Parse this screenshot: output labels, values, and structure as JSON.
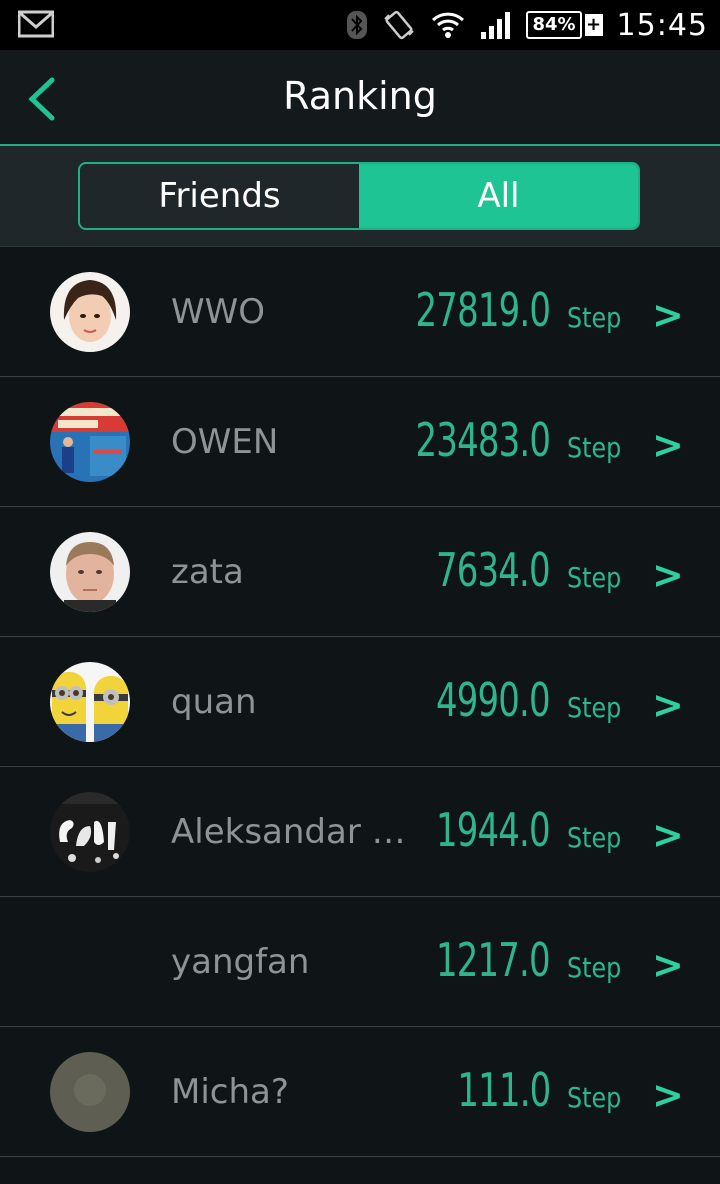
{
  "status_bar": {
    "time": "15:45",
    "battery": "84%",
    "battery_plus": "+",
    "icons": [
      "gmail-icon",
      "bluetooth-icon",
      "vibrate-icon",
      "wifi-icon",
      "signal-icon",
      "battery-icon"
    ]
  },
  "header": {
    "title": "Ranking",
    "back_icon": "chevron-left-icon"
  },
  "tabs": [
    {
      "label": "Friends",
      "active": false
    },
    {
      "label": "All",
      "active": true
    }
  ],
  "ranking": [
    {
      "name": "WWO",
      "steps": "27819.0",
      "unit": "Step",
      "arrow": ">",
      "avatar": "woman-photo"
    },
    {
      "name": "OWEN",
      "steps": "23483.0",
      "unit": "Step",
      "arrow": ">",
      "avatar": "banner-photo"
    },
    {
      "name": "zata",
      "steps": "7634.0",
      "unit": "Step",
      "arrow": ">",
      "avatar": "man-photo"
    },
    {
      "name": "quan",
      "steps": "4990.0",
      "unit": "Step",
      "arrow": ">",
      "avatar": "minions-photo"
    },
    {
      "name": "Aleksandar L...",
      "steps": "1944.0",
      "unit": "Step",
      "arrow": ">",
      "avatar": "cafe-photo"
    },
    {
      "name": "yangfan",
      "steps": "1217.0",
      "unit": "Step",
      "arrow": ">",
      "avatar": "none"
    },
    {
      "name": "Micha?",
      "steps": "111.0",
      "unit": "Step",
      "arrow": ">",
      "avatar": "grey-photo"
    }
  ],
  "colors": {
    "accent": "#1fc495",
    "score": "#2fb58a",
    "background": "#0f1416"
  }
}
